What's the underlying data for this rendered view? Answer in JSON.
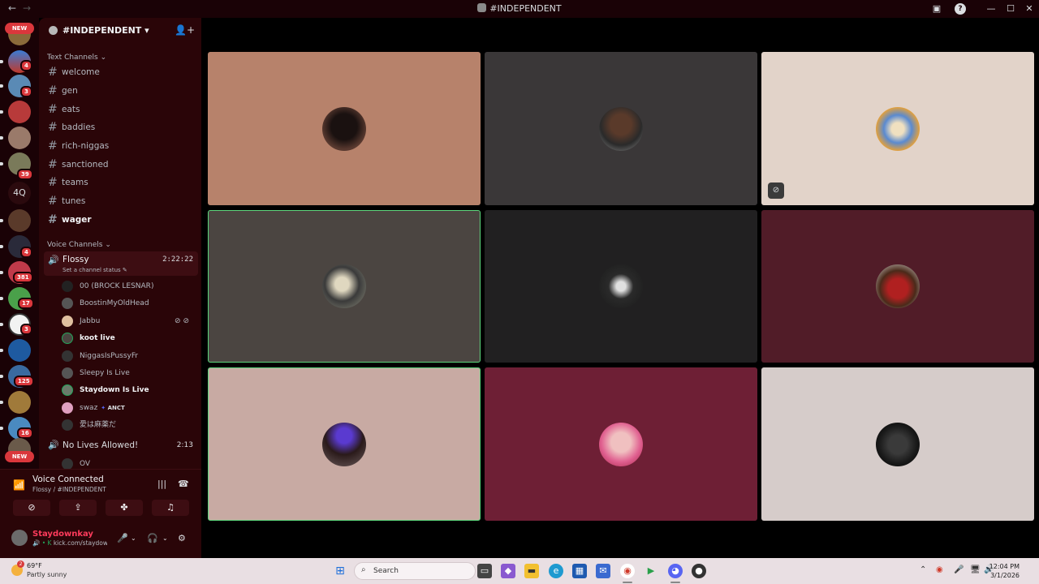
{
  "window": {
    "title": "#INDEPENDENT",
    "back_icon": "←",
    "forward_icon": "→"
  },
  "rail": {
    "new_label": "NEW",
    "bottom_new_label": "NEW",
    "text_server": "4Q",
    "badges": [
      "4",
      "3",
      "39",
      "4",
      "381",
      "17",
      "3",
      "125",
      "16"
    ]
  },
  "guild": {
    "name": "#INDEPENDENT",
    "chevron": "▾"
  },
  "text_channels": {
    "category": "Text Channels",
    "items": [
      "welcome",
      "gen",
      "eats",
      "baddies",
      "rich-niggas",
      "sanctioned",
      "teams",
      "tunes",
      "wager"
    ]
  },
  "voice_channels": {
    "category": "Voice Channels",
    "active": {
      "name": "Flossy",
      "elapsed": "2:22:22",
      "status_placeholder": "Set a channel status"
    },
    "users": [
      {
        "name": "00 (BROCK LESNAR)",
        "bold": false
      },
      {
        "name": "BoostinMyOldHead",
        "bold": false
      },
      {
        "name": "Jabbu",
        "bold": false
      },
      {
        "name": "koot live",
        "bold": true
      },
      {
        "name": "NiggasIsPussyFr",
        "bold": false
      },
      {
        "name": "Sleepy Is Live",
        "bold": false
      },
      {
        "name": "Staydown Is Live",
        "bold": true
      },
      {
        "name": "swaz",
        "bold": false,
        "tag": "ANCT"
      },
      {
        "name": "愛は麻薬だ",
        "bold": false
      }
    ],
    "second": {
      "name": "No Lives Allowed!",
      "elapsed": "2:13",
      "user": "OV"
    }
  },
  "voice_panel": {
    "title": "Voice Connected",
    "subtitle": "Flossy / #INDEPENDENT"
  },
  "user_panel": {
    "name": "Staydownkay",
    "status": "kick.com/staydown"
  },
  "taskbar": {
    "temp": "69°F",
    "condition": "Partly sunny",
    "weather_badge": "2",
    "search_placeholder": "Search",
    "time": "12:04 PM",
    "date": "3/1/2026"
  },
  "colors": {
    "sidebar_bg": "#2a0508",
    "rail_bg": "#1a0206",
    "speaking_border": "#5cd67c",
    "online_green": "#23a55a",
    "badge_red": "#da373c",
    "tiles": [
      "#b7826b",
      "#3a3738",
      "#e2d3c9",
      "#4b4541",
      "#212021",
      "#511c28",
      "#c8aaa3",
      "#6e1f35",
      "#d6ccca"
    ]
  }
}
